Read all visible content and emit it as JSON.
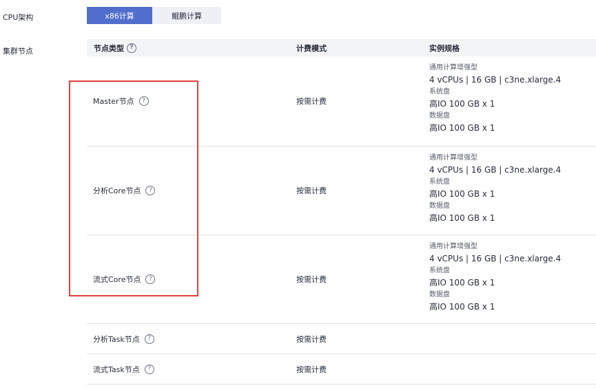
{
  "labels": {
    "cpu_arch": "CPU架构",
    "cluster_nodes": "集群节点"
  },
  "cpu_arch": {
    "options": [
      "x86计算",
      "鲲鹏计算"
    ],
    "selected": "x86计算"
  },
  "table": {
    "headers": {
      "node_type": "节点类型",
      "billing": "计费模式",
      "spec": "实例规格"
    },
    "rows": [
      {
        "node_type": "Master节点",
        "billing": "按需计费",
        "spec": {
          "family": "通用计算增强型",
          "flavor": "4 vCPUs | 16 GB | c3ne.xlarge.4",
          "sys_disk_label": "系统盘",
          "sys_disk": "高IO 100 GB x 1",
          "data_disk_label": "数据盘",
          "data_disk": "高IO 100 GB x 1"
        }
      },
      {
        "node_type": "分析Core节点",
        "billing": "按需计费",
        "spec": {
          "family": "通用计算增强型",
          "flavor": "4 vCPUs | 16 GB | c3ne.xlarge.4",
          "sys_disk_label": "系统盘",
          "sys_disk": "高IO 100 GB x 1",
          "data_disk_label": "数据盘",
          "data_disk": "高IO 100 GB x 1"
        }
      },
      {
        "node_type": "流式Core节点",
        "billing": "按需计费",
        "spec": {
          "family": "通用计算增强型",
          "flavor": "4 vCPUs | 16 GB | c3ne.xlarge.4",
          "sys_disk_label": "系统盘",
          "sys_disk": "高IO 100 GB x 1",
          "data_disk_label": "数据盘",
          "data_disk": "高IO 100 GB x 1"
        }
      },
      {
        "node_type": "分析Task节点",
        "billing": "按需计费"
      },
      {
        "node_type": "流式Task节点",
        "billing": "按需计费"
      }
    ]
  },
  "icons": {
    "help": "question-circle-icon",
    "help_glyph": "?"
  },
  "colors": {
    "accent": "#526ecc",
    "highlight_box": "#e0403a"
  }
}
